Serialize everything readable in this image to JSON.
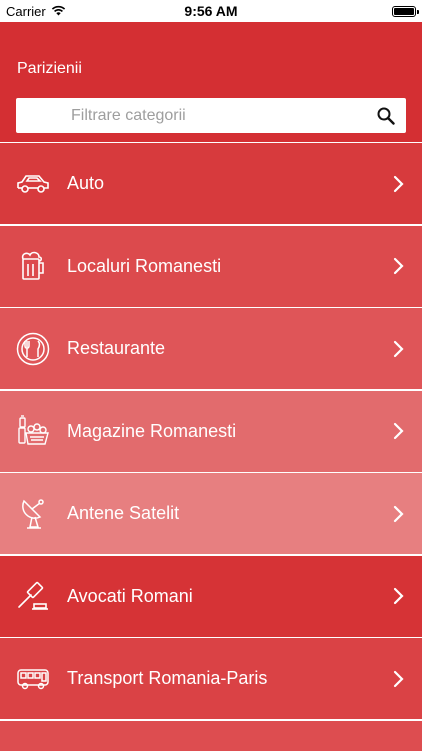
{
  "status_bar": {
    "carrier": "Carrier",
    "time": "9:56 AM"
  },
  "header": {
    "title": "Parizienii",
    "background": "#d42f33"
  },
  "search": {
    "placeholder": "Filtrare categorii",
    "value": "",
    "icon": "search-icon"
  },
  "categories": [
    {
      "label": "Auto",
      "icon": "car-icon",
      "color": "#d73a3d"
    },
    {
      "label": "Localuri Romanesti",
      "icon": "beer-mug-icon",
      "color": "#dc4a4d"
    },
    {
      "label": "Restaurante",
      "icon": "plate-cutlery-icon",
      "color": "#df5558"
    },
    {
      "label": "Magazine Romanesti",
      "icon": "grocery-icon",
      "color": "#e26b6d"
    },
    {
      "label": "Antene Satelit",
      "icon": "satellite-dish-icon",
      "color": "#e77f80"
    },
    {
      "label": "Avocati Romani",
      "icon": "gavel-icon",
      "color": "#d63336"
    },
    {
      "label": "Transport Romania-Paris",
      "icon": "bus-icon",
      "color": "#da4245"
    }
  ],
  "more_row_color": "#dd4d50"
}
